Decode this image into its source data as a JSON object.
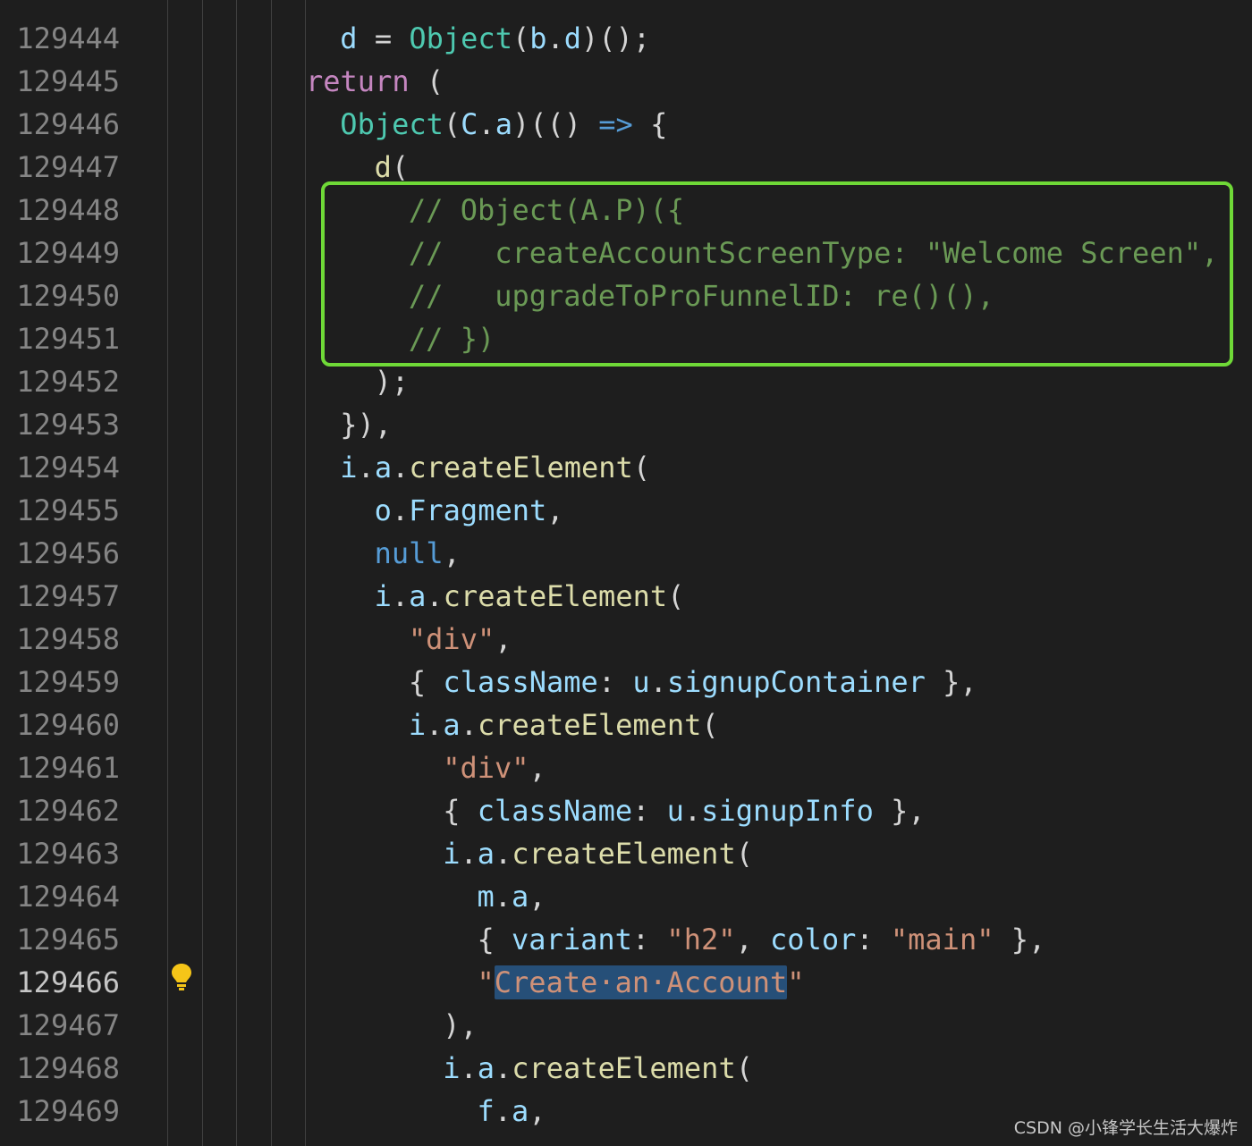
{
  "editor": {
    "lines": [
      {
        "num": "129444",
        "indent": 1,
        "tokens": [
          [
            "var",
            "d"
          ],
          [
            "punc",
            " = "
          ],
          [
            "type",
            "Object"
          ],
          [
            "punc",
            "("
          ],
          [
            "var",
            "b"
          ],
          [
            "punc",
            "."
          ],
          [
            "var",
            "d"
          ],
          [
            "punc",
            ")();"
          ]
        ]
      },
      {
        "num": "129445",
        "indent": 0,
        "tokens": [
          [
            "kw",
            "return"
          ],
          [
            "punc",
            " ("
          ]
        ]
      },
      {
        "num": "129446",
        "indent": 1,
        "tokens": [
          [
            "type",
            "Object"
          ],
          [
            "punc",
            "("
          ],
          [
            "var",
            "C"
          ],
          [
            "punc",
            "."
          ],
          [
            "var",
            "a"
          ],
          [
            "punc",
            ")(() "
          ],
          [
            "const",
            "=>"
          ],
          [
            "punc",
            " {"
          ]
        ]
      },
      {
        "num": "129447",
        "indent": 2,
        "tokens": [
          [
            "fn",
            "d"
          ],
          [
            "punc",
            "("
          ]
        ]
      },
      {
        "num": "129448",
        "indent": 3,
        "tokens": [
          [
            "cmt",
            "// Object(A.P)({"
          ]
        ]
      },
      {
        "num": "129449",
        "indent": 3,
        "tokens": [
          [
            "cmt",
            "//   createAccountScreenType: \"Welcome Screen\","
          ]
        ]
      },
      {
        "num": "129450",
        "indent": 3,
        "tokens": [
          [
            "cmt",
            "//   upgradeToProFunnelID: re()(),"
          ]
        ]
      },
      {
        "num": "129451",
        "indent": 3,
        "tokens": [
          [
            "cmt",
            "// })"
          ]
        ]
      },
      {
        "num": "129452",
        "indent": 2,
        "tokens": [
          [
            "punc",
            ");"
          ]
        ]
      },
      {
        "num": "129453",
        "indent": 1,
        "tokens": [
          [
            "punc",
            "}),"
          ]
        ]
      },
      {
        "num": "129454",
        "indent": 1,
        "tokens": [
          [
            "var",
            "i"
          ],
          [
            "punc",
            "."
          ],
          [
            "var",
            "a"
          ],
          [
            "punc",
            "."
          ],
          [
            "fn",
            "createElement"
          ],
          [
            "punc",
            "("
          ]
        ]
      },
      {
        "num": "129455",
        "indent": 2,
        "tokens": [
          [
            "var",
            "o"
          ],
          [
            "punc",
            "."
          ],
          [
            "var",
            "Fragment"
          ],
          [
            "punc",
            ","
          ]
        ]
      },
      {
        "num": "129456",
        "indent": 2,
        "tokens": [
          [
            "const",
            "null"
          ],
          [
            "punc",
            ","
          ]
        ]
      },
      {
        "num": "129457",
        "indent": 2,
        "tokens": [
          [
            "var",
            "i"
          ],
          [
            "punc",
            "."
          ],
          [
            "var",
            "a"
          ],
          [
            "punc",
            "."
          ],
          [
            "fn",
            "createElement"
          ],
          [
            "punc",
            "("
          ]
        ]
      },
      {
        "num": "129458",
        "indent": 3,
        "tokens": [
          [
            "str",
            "\"div\""
          ],
          [
            "punc",
            ","
          ]
        ]
      },
      {
        "num": "129459",
        "indent": 3,
        "tokens": [
          [
            "punc",
            "{ "
          ],
          [
            "var",
            "className"
          ],
          [
            "punc",
            ": "
          ],
          [
            "var",
            "u"
          ],
          [
            "punc",
            "."
          ],
          [
            "var",
            "signupContainer"
          ],
          [
            "punc",
            " },"
          ]
        ]
      },
      {
        "num": "129460",
        "indent": 3,
        "tokens": [
          [
            "var",
            "i"
          ],
          [
            "punc",
            "."
          ],
          [
            "var",
            "a"
          ],
          [
            "punc",
            "."
          ],
          [
            "fn",
            "createElement"
          ],
          [
            "punc",
            "("
          ]
        ]
      },
      {
        "num": "129461",
        "indent": 4,
        "tokens": [
          [
            "str",
            "\"div\""
          ],
          [
            "punc",
            ","
          ]
        ]
      },
      {
        "num": "129462",
        "indent": 4,
        "tokens": [
          [
            "punc",
            "{ "
          ],
          [
            "var",
            "className"
          ],
          [
            "punc",
            ": "
          ],
          [
            "var",
            "u"
          ],
          [
            "punc",
            "."
          ],
          [
            "var",
            "signupInfo"
          ],
          [
            "punc",
            " },"
          ]
        ]
      },
      {
        "num": "129463",
        "indent": 4,
        "tokens": [
          [
            "var",
            "i"
          ],
          [
            "punc",
            "."
          ],
          [
            "var",
            "a"
          ],
          [
            "punc",
            "."
          ],
          [
            "fn",
            "createElement"
          ],
          [
            "punc",
            "("
          ]
        ]
      },
      {
        "num": "129464",
        "indent": 5,
        "tokens": [
          [
            "var",
            "m"
          ],
          [
            "punc",
            "."
          ],
          [
            "var",
            "a"
          ],
          [
            "punc",
            ","
          ]
        ]
      },
      {
        "num": "129465",
        "indent": 5,
        "tokens": [
          [
            "punc",
            "{ "
          ],
          [
            "var",
            "variant"
          ],
          [
            "punc",
            ": "
          ],
          [
            "str",
            "\"h2\""
          ],
          [
            "punc",
            ", "
          ],
          [
            "var",
            "color"
          ],
          [
            "punc",
            ": "
          ],
          [
            "str",
            "\"main\""
          ],
          [
            "punc",
            " },"
          ]
        ]
      },
      {
        "num": "129466",
        "indent": 5,
        "active": true,
        "tokens": [
          [
            "str",
            "\""
          ],
          [
            "strsel",
            "Create·an·Account"
          ],
          [
            "str",
            "\""
          ]
        ]
      },
      {
        "num": "129467",
        "indent": 4,
        "tokens": [
          [
            "punc",
            "),"
          ]
        ]
      },
      {
        "num": "129468",
        "indent": 4,
        "tokens": [
          [
            "var",
            "i"
          ],
          [
            "punc",
            "."
          ],
          [
            "var",
            "a"
          ],
          [
            "punc",
            "."
          ],
          [
            "fn",
            "createElement"
          ],
          [
            "punc",
            "("
          ]
        ]
      },
      {
        "num": "129469",
        "indent": 5,
        "tokens": [
          [
            "var",
            "f"
          ],
          [
            "punc",
            "."
          ],
          [
            "var",
            "a"
          ],
          [
            "punc",
            ","
          ]
        ]
      }
    ]
  },
  "watermark": "CSDN @小锋学长生活大爆炸",
  "colors": {
    "highlight_box": "#6fd937",
    "selection": "#264f78",
    "lightbulb": "#f5c518"
  }
}
